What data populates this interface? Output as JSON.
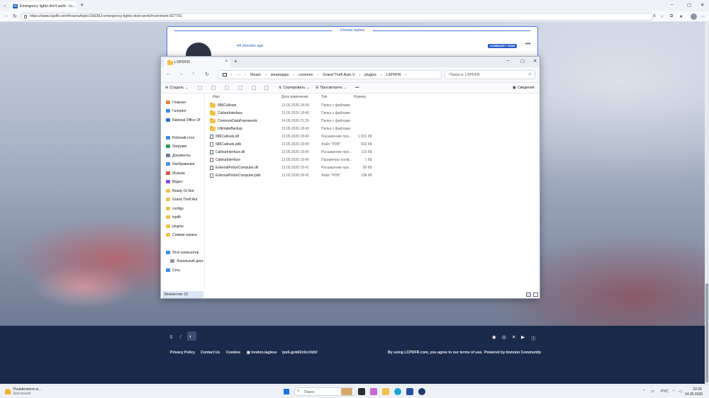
{
  "browser": {
    "tab_title": "Emergency lights don't work - Lc...",
    "url": "https://www.lcpdfr.com/forums/topic/156302-emergency-lights-dont-work/#comment-827791"
  },
  "forum": {
    "unread_label": "Unread replies",
    "post_time": "44 minutes ago",
    "badge": "COMMUNITY TEAM",
    "more": "•••"
  },
  "explorer": {
    "tab_title": "LSPDFR",
    "breadcrumbs": [
      "Steam",
      "steamapps",
      "common",
      "Grand Theft Auto V",
      "plugins",
      "LSPDFR"
    ],
    "search_placeholder": "Поиск в: LSPDFR",
    "commands": {
      "create": "Создать",
      "sort": "Сортировать",
      "view": "Просмотреть",
      "more": "•••",
      "details": "Сведения"
    },
    "nav": [
      {
        "label": "Главная",
        "color": "#e2833b"
      },
      {
        "label": "Галерея",
        "color": "#3b8ee2"
      },
      {
        "label": "National Office Of",
        "color": "#2f6fce"
      },
      {
        "label": "Рабочий стол",
        "color": "#3b8ee2"
      },
      {
        "label": "Загрузки",
        "color": "#2a9b5c"
      },
      {
        "label": "Документы",
        "color": "#6a7b95"
      },
      {
        "label": "Изображения",
        "color": "#4a90d9"
      },
      {
        "label": "Музыка",
        "color": "#d9534f"
      },
      {
        "label": "Видео",
        "color": "#8a4fd9"
      },
      {
        "label": "Ready Or Not",
        "color": "#f2c24a"
      },
      {
        "label": "Grand Theft Aut",
        "color": "#f2c24a"
      },
      {
        "label": "configs",
        "color": "#f2c24a"
      },
      {
        "label": "lspdfr",
        "color": "#f2c24a"
      },
      {
        "label": "plugins",
        "color": "#f2c24a"
      },
      {
        "label": "Снимки экрана",
        "color": "#f2c24a"
      },
      {
        "label": "Этот компьютер",
        "color": "#3b8ee2"
      },
      {
        "label": "Локальный диск",
        "color": "#8a96a8"
      },
      {
        "label": "Сеть",
        "color": "#3b8ee2"
      }
    ],
    "columns": [
      "Имя",
      "Дата изменения",
      "Тип",
      "Размер"
    ],
    "files": [
      {
        "name": "686Callouts",
        "date": "13.05.2026 18:39",
        "type": "Папка с файлами",
        "size": "",
        "kind": "folder"
      },
      {
        "name": "CalloutInterface",
        "date": "13.05.2026 18:40",
        "type": "Папка с файлами",
        "size": "",
        "kind": "folder"
      },
      {
        "name": "CommonDataFramework",
        "date": "14.05.2026 21:26",
        "type": "Папка с файлами",
        "size": "",
        "kind": "folder"
      },
      {
        "name": "UltimateBackup",
        "date": "13.05.2026 18:43",
        "type": "Папка с файлами",
        "size": "",
        "kind": "folder"
      },
      {
        "name": "686Callouts.dll",
        "date": "13.05.2026 18:40",
        "type": "Расширение при...",
        "size": "1 831 КБ",
        "kind": "dll"
      },
      {
        "name": "686Callouts.pdb",
        "date": "13.05.2026 18:40",
        "type": "Файл \"PDB\"",
        "size": "602 КБ",
        "kind": "file"
      },
      {
        "name": "CalloutInterface.dll",
        "date": "13.05.2026 18:40",
        "type": "Расширение при...",
        "size": "115 КБ",
        "kind": "dll"
      },
      {
        "name": "CalloutInterface",
        "date": "13.05.2026 18:40",
        "type": "Параметры конф...",
        "size": "1 КБ",
        "kind": "file"
      },
      {
        "name": "ExternalPoliceComputer.dll",
        "date": "13.05.2026 18:41",
        "type": "Расширение при...",
        "size": "80 КБ",
        "kind": "dll"
      },
      {
        "name": "ExternalPoliceComputer.pdb",
        "date": "13.05.2026 18:41",
        "type": "Файл \"PDB\"",
        "size": "198 КБ",
        "kind": "file"
      }
    ],
    "status": "Элементов: 10"
  },
  "footer": {
    "links": [
      "Privacy Policy",
      "Contact Us",
      "Cookies",
      "london.lagless",
      "ips5-gold/2c0cc0d1f"
    ],
    "terms": "By using LCPDFR.com, you agree to our terms of use.",
    "powered": "Powered by Invision Community"
  },
  "taskbar": {
    "weather_title": "Thunderstorm w...",
    "weather_sub": "Just issued",
    "search_placeholder": "Поиск",
    "lang": "РУС",
    "time": "22:26",
    "date": "14.05.2026"
  }
}
